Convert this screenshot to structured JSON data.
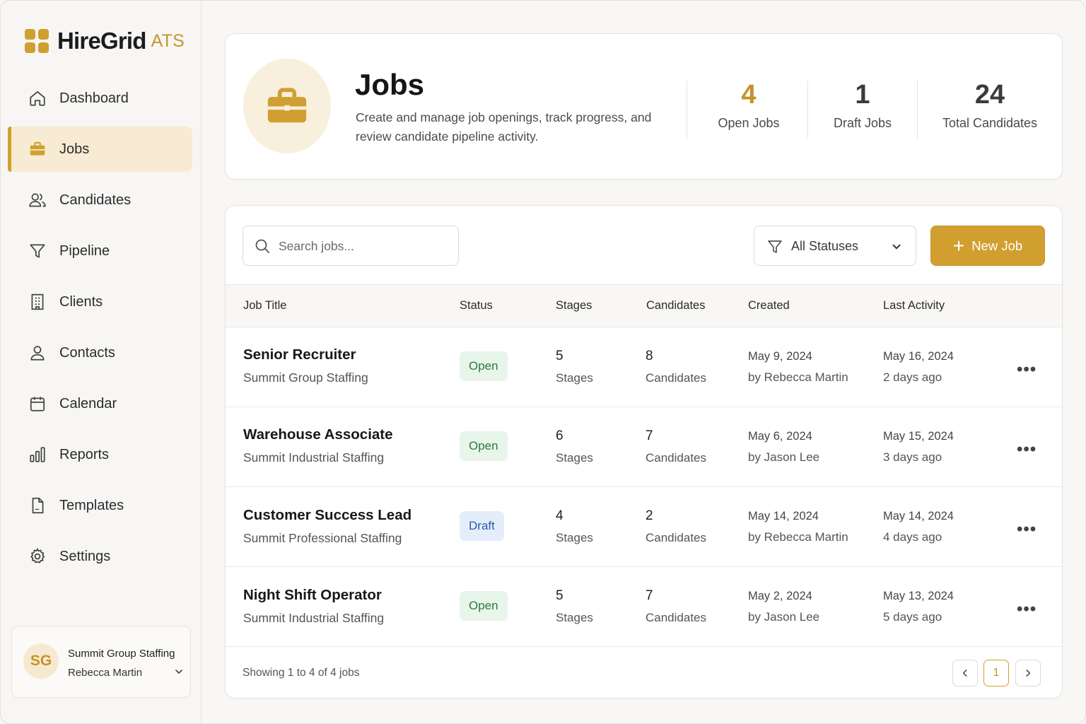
{
  "brand": {
    "name": "HireGrid",
    "suffix": "ATS",
    "accent": "#d19f30"
  },
  "sidebar": {
    "items": [
      {
        "label": "Dashboard",
        "icon": "home-icon"
      },
      {
        "label": "Jobs",
        "icon": "briefcase-icon",
        "active": true
      },
      {
        "label": "Candidates",
        "icon": "users-icon"
      },
      {
        "label": "Pipeline",
        "icon": "funnel-icon"
      },
      {
        "label": "Clients",
        "icon": "building-icon"
      },
      {
        "label": "Contacts",
        "icon": "user-icon"
      },
      {
        "label": "Calendar",
        "icon": "calendar-icon"
      },
      {
        "label": "Reports",
        "icon": "bar-chart-icon"
      },
      {
        "label": "Templates",
        "icon": "document-icon"
      },
      {
        "label": "Settings",
        "icon": "gear-icon"
      }
    ],
    "org": {
      "initials": "SG",
      "name": "Summit Group Staffing",
      "user": "Rebecca Martin"
    }
  },
  "header": {
    "title": "Jobs",
    "description": "Create and manage job openings, track progress, and review candidate pipeline activity.",
    "stats": [
      {
        "value": "4",
        "label": "Open Jobs",
        "color": "#c6922a"
      },
      {
        "value": "1",
        "label": "Draft Jobs",
        "color": "#3b3b3b"
      },
      {
        "value": "24",
        "label": "Total Candidates",
        "color": "#3b3b3b"
      }
    ]
  },
  "toolbar": {
    "search_placeholder": "Search jobs...",
    "filter_label": "All Statuses",
    "new_job_label": "New Job"
  },
  "table": {
    "columns": [
      "Job Title",
      "Status",
      "Stages",
      "Candidates",
      "Created",
      "Last Activity"
    ],
    "rows": [
      {
        "title": "Senior Recruiter",
        "client": "Summit Group Staffing",
        "status": "Open",
        "stages": "5",
        "stages_label": "Stages",
        "candidates": "8",
        "candidates_label": "Candidates",
        "created": "May 9, 2024",
        "created_by": "by Rebecca Martin",
        "last_activity": "May 16, 2024",
        "last_ago": "2 days ago"
      },
      {
        "title": "Warehouse Associate",
        "client": "Summit Industrial Staffing",
        "status": "Open",
        "stages": "6",
        "stages_label": "Stages",
        "candidates": "7",
        "candidates_label": "Candidates",
        "created": "May 6, 2024",
        "created_by": "by Jason Lee",
        "last_activity": "May 15, 2024",
        "last_ago": "3 days ago"
      },
      {
        "title": "Customer Success Lead",
        "client": "Summit Professional Staffing",
        "status": "Draft",
        "stages": "4",
        "stages_label": "Stages",
        "candidates": "2",
        "candidates_label": "Candidates",
        "created": "May 14, 2024",
        "created_by": "by Rebecca Martin",
        "last_activity": "May 14, 2024",
        "last_ago": "4 days ago"
      },
      {
        "title": "Night Shift Operator",
        "client": "Summit Industrial Staffing",
        "status": "Open",
        "stages": "5",
        "stages_label": "Stages",
        "candidates": "7",
        "candidates_label": "Candidates",
        "created": "May 2, 2024",
        "created_by": "by Jason Lee",
        "last_activity": "May 13, 2024",
        "last_ago": "5 days ago"
      }
    ],
    "row_menu": "•••"
  },
  "pagination": {
    "summary": "Showing 1 to 4 of 4 jobs",
    "current_page": "1",
    "prev_icon": "chevron-left-icon",
    "next_icon": "chevron-right-icon"
  }
}
